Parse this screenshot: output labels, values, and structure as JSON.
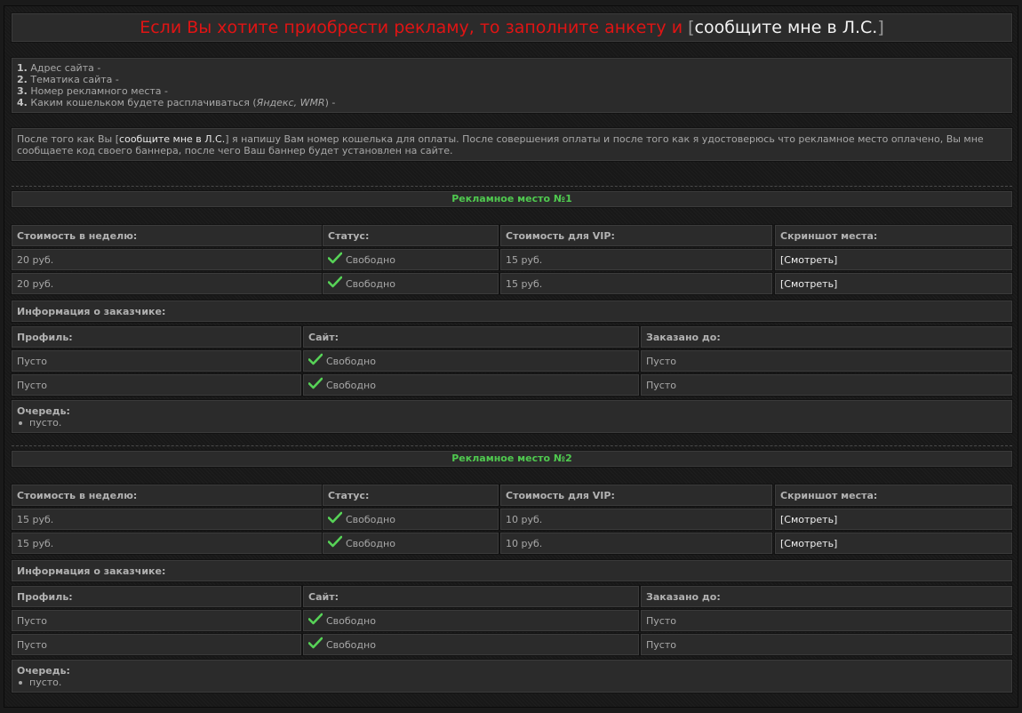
{
  "header": {
    "text": "Если Вы хотите приобрести рекламу, то заполните анкету и",
    "bracket_open": "[",
    "link": "сообщите мне в Л.С.",
    "bracket_close": "]"
  },
  "form_items": [
    {
      "num": "1.",
      "label": "Адрес сайта -"
    },
    {
      "num": "2.",
      "label": "Тематика сайта -"
    },
    {
      "num": "3.",
      "label": "Номер рекламного места -"
    },
    {
      "num": "4.",
      "label_before": "Каким кошельком будете расплачиваться (",
      "label_italic": "Яндекс, WMR",
      "label_after": ") -"
    }
  ],
  "info": {
    "before": "После того как Вы [",
    "link": "сообщите мне в Л.С.",
    "after": "] я напишу Вам номер кошелька для оплаты. После совершения оплаты и после того как я удостоверюсь что рекламное место оплачено, Вы мне сообщаете код своего баннера, после чего Ваш баннер будет установлен на сайте."
  },
  "columns": {
    "price": "Стоимость в неделю:",
    "status": "Статус:",
    "vip": "Стоимость для VIP:",
    "screenshot": "Скриншот места:",
    "customer_info": "Информация о заказчике:",
    "profile": "Профиль:",
    "site": "Сайт:",
    "ordered_until": "Заказано до:",
    "queue": "Очередь:"
  },
  "sections": [
    {
      "title": "Рекламное место №1",
      "rows": [
        {
          "price": "20 руб.",
          "status": "Свободно",
          "vip": "15 руб.",
          "screenshot": "[Смотреть]"
        },
        {
          "price": "20 руб.",
          "status": "Свободно",
          "vip": "15 руб.",
          "screenshot": "[Смотреть]"
        }
      ],
      "customers": [
        {
          "profile": "Пусто",
          "site": "Свободно",
          "until": "Пусто"
        },
        {
          "profile": "Пусто",
          "site": "Свободно",
          "until": "Пусто"
        }
      ],
      "queue": [
        "пусто."
      ]
    },
    {
      "title": "Рекламное место №2",
      "rows": [
        {
          "price": "15 руб.",
          "status": "Свободно",
          "vip": "10 руб.",
          "screenshot": "[Смотреть]"
        },
        {
          "price": "15 руб.",
          "status": "Свободно",
          "vip": "10 руб.",
          "screenshot": "[Смотреть]"
        }
      ],
      "customers": [
        {
          "profile": "Пусто",
          "site": "Свободно",
          "until": "Пусто"
        },
        {
          "profile": "Пусто",
          "site": "Свободно",
          "until": "Пусто"
        }
      ],
      "queue": [
        "пусто."
      ]
    }
  ],
  "colors": {
    "header_text": "#e01414",
    "section_title": "#4fc94f",
    "check_icon": "#57d357",
    "link": "#f0f0f0"
  },
  "icons": {
    "status": "check-icon"
  }
}
